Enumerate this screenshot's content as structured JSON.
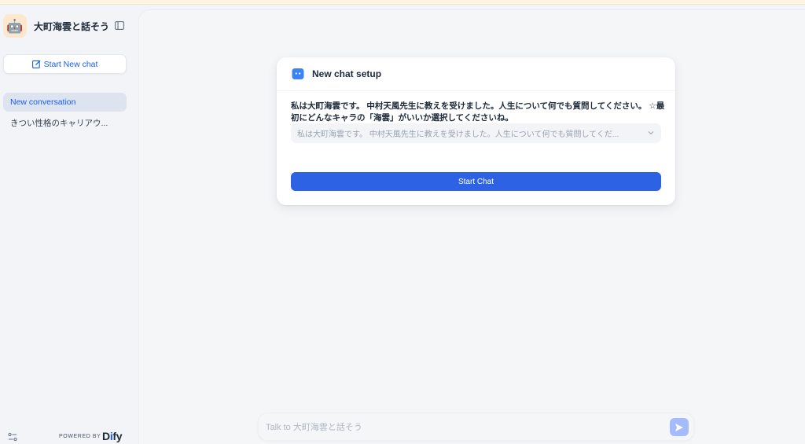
{
  "app": {
    "title": "大町海雲と話そう",
    "avatar_emoji": "🤖"
  },
  "sidebar": {
    "new_chat_label": "Start New chat",
    "conversations": [
      {
        "label": "New conversation",
        "active": true
      },
      {
        "label": "きつい性格のキャリアウ..."
      }
    ],
    "footer": {
      "powered_by": "POWERED BY",
      "brand": "Dify"
    }
  },
  "setup_card": {
    "title": "New chat setup",
    "prompt": "私は大町海雲です。 中村天風先生に教えを受けました。人生について何でも質問してください。 ☆最初にどんなキャラの「海雲」がいいか選択してくださいね。",
    "select_value": "私は大町海雲です。 中村天風先生に教えを受けました。人生について何でも質問してくだ...",
    "start_button": "Start Chat"
  },
  "chat_input": {
    "placeholder": "Talk to 大町海雲と話そう"
  },
  "colors": {
    "accent": "#155eef",
    "primary_button": "#2c62e3",
    "send_button": "#a4bcfd"
  },
  "icons": [
    "collapse-sidebar-icon",
    "edit-icon",
    "settings-icon",
    "robot-icon",
    "chevron-down-icon",
    "send-icon"
  ]
}
